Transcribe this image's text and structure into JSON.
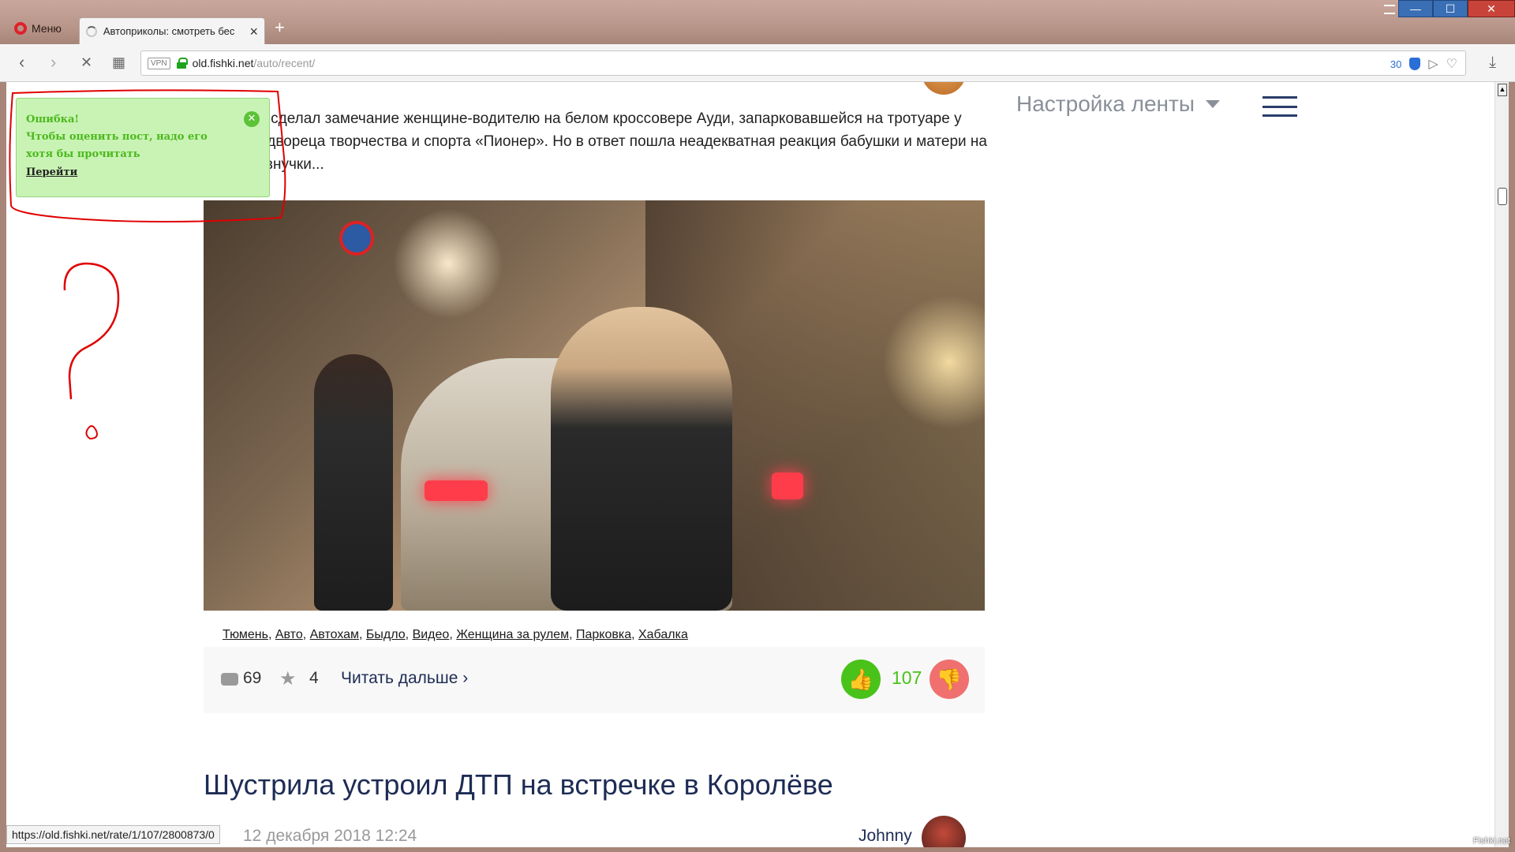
{
  "browser": {
    "menu_label": "Меню",
    "tab_title": "Автоприколы: смотреть бес",
    "new_tab": "+",
    "url_host": "old.fishki.net",
    "url_path": "/auto/recent/",
    "vpn_label": "VPN",
    "adblock_count": "30",
    "window_buttons": {
      "minimize": "—",
      "maximize": "☐",
      "close": "✕"
    }
  },
  "page": {
    "article_text": "Мужчина сделал замечание женщине-водителю на белом кроссовере Ауди, запарковавшейся на тротуаре у крыльца двореца творчества и спорта «Пионер». Но в ответ пошла неадекватная реакция бабушки и матери на глаза их внучки...",
    "feed_settings": "Настройка ленты",
    "tags": [
      "Тюмень",
      "Авто",
      "Автохам",
      "Быдло",
      "Видео",
      "Женщина за рулем",
      "Парковка",
      "Хабалка"
    ],
    "comments": "69",
    "stars": "4",
    "read_more": "Читать дальше ›",
    "likes": "107",
    "next_title": "Шустрила устроил ДТП на встречке в Королёве",
    "next_date": "12 декабря 2018 12:24",
    "next_author": "Johnny"
  },
  "notification": {
    "title": "Ошибка!",
    "message": "Чтобы оценить пост, надо его хотя бы прочитать",
    "link": "Перейти"
  },
  "status_bar": {
    "url": "https://old.fishki.net/rate/1/107/2800873/0"
  },
  "watermark": "Fishki.net",
  "colors": {
    "like": "#49c21a",
    "dislike": "#f07070",
    "link_dark": "#1d2c55",
    "note_bg": "#c9f3b4",
    "annotation": "#e00000"
  }
}
